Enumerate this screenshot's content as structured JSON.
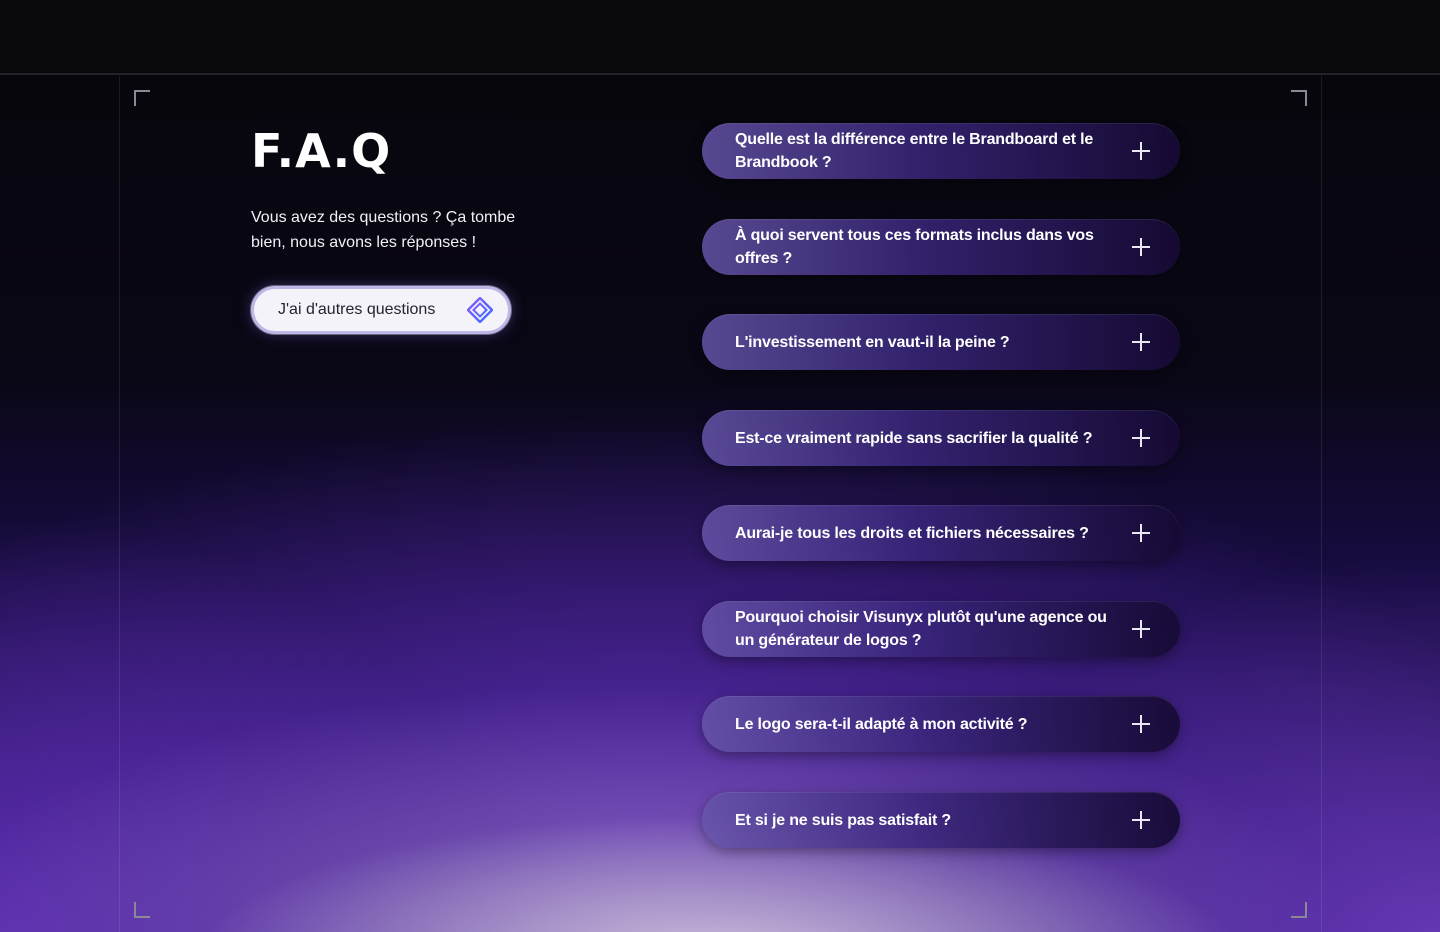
{
  "faq_section": {
    "title": "F.A.Q",
    "subtitle": "Vous avez des questions ? Ça tombe bien, nous avons les réponses !",
    "cta_label": "J'ai d'autres questions",
    "cta_icon": "diamond-logo-icon"
  },
  "questions": [
    "Quelle est la différence entre le Brandboard et le Brandbook ?",
    "À quoi servent tous ces formats inclus dans vos offres ?",
    "L'investissement en vaut-il la peine ?",
    "Est-ce vraiment rapide sans sacrifier la qualité ?",
    "Aurai-je tous les droits et fichiers nécessaires ?",
    "Pourquoi choisir Visunyx plutôt qu'une agence ou un générateur de logos ?",
    "Le logo sera-t-il adapté à mon activité ?",
    "Et si je ne suis pas satisfait ?"
  ],
  "expand_icon": "plus-icon",
  "colors": {
    "background": "#07060c",
    "accent_purple": "#6a3fd0",
    "pill_start": "#6654a8",
    "pill_end": "#160a34"
  }
}
